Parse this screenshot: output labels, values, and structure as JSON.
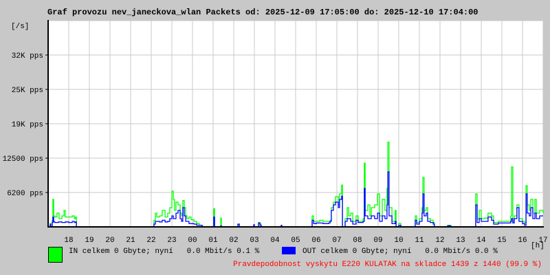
{
  "title": "Graf provozu nev_janeckova_wlan Packets od: 2025-12-09 17:05:00 do: 2025-12-10 17:04:00",
  "legend": {
    "in": {
      "text": "IN celkem 0 Gbyte; nyní   0.0 Mbit/s 0.1 %",
      "color": "#00ff00"
    },
    "out": {
      "text": "OUT celkem 0 Gbyte; nyní   0.0 Mbit/s 0.0 %",
      "color": "#0000ff"
    }
  },
  "footer": {
    "text": "Pravdepodobnost vyskytu E220 KULATAK na skladce 1439 z 1440 (99.9 %)",
    "color": "#ff0000"
  },
  "chart_data": {
    "type": "line",
    "title": "Graf provozu nev_janeckova_wlan Packets od: 2025-12-09 17:05:00 do: 2025-12-10 17:04:00",
    "ylabel": "[/s]",
    "xlabel": "[h]",
    "ylim": [
      0,
      37500
    ],
    "xlim_hours": [
      0,
      24
    ],
    "grid": true,
    "y_ticks": [
      {
        "value": 6250,
        "label": "6200 pps"
      },
      {
        "value": 12500,
        "label": "12500 pps"
      },
      {
        "value": 18750,
        "label": "19K pps"
      },
      {
        "value": 25000,
        "label": "25K pps"
      },
      {
        "value": 31250,
        "label": "32K pps"
      }
    ],
    "x_ticks": [
      "18",
      "19",
      "20",
      "21",
      "22",
      "23",
      "00",
      "01",
      "02",
      "03",
      "04",
      "05",
      "06",
      "07",
      "08",
      "09",
      "10",
      "11",
      "12",
      "13",
      "14",
      "15",
      "16",
      "17"
    ],
    "series": [
      {
        "name": "IN",
        "color": "#00ff00",
        "points": [
          [
            0,
            0
          ],
          [
            0.07,
            0
          ],
          [
            0.1,
            600
          ],
          [
            0.13,
            0
          ],
          [
            0.2,
            1200
          ],
          [
            0.23,
            5000
          ],
          [
            0.27,
            2000
          ],
          [
            0.33,
            1800
          ],
          [
            0.43,
            2500
          ],
          [
            0.53,
            1500
          ],
          [
            0.67,
            2000
          ],
          [
            0.77,
            3000
          ],
          [
            0.83,
            1800
          ],
          [
            1.0,
            1800
          ],
          [
            1.17,
            2000
          ],
          [
            1.27,
            1500
          ],
          [
            1.33,
            1800
          ],
          [
            1.37,
            0
          ],
          [
            5.07,
            0
          ],
          [
            5.13,
            1200
          ],
          [
            5.2,
            2500
          ],
          [
            5.27,
            1800
          ],
          [
            5.4,
            2000
          ],
          [
            5.53,
            3000
          ],
          [
            5.67,
            1800
          ],
          [
            5.8,
            2500
          ],
          [
            5.9,
            3500
          ],
          [
            6.0,
            6500
          ],
          [
            6.07,
            5000
          ],
          [
            6.13,
            3000
          ],
          [
            6.2,
            4500
          ],
          [
            6.3,
            4000
          ],
          [
            6.4,
            2500
          ],
          [
            6.47,
            2000
          ],
          [
            6.53,
            4800
          ],
          [
            6.6,
            3500
          ],
          [
            6.67,
            2000
          ],
          [
            6.73,
            1500
          ],
          [
            6.83,
            1800
          ],
          [
            6.93,
            1300
          ],
          [
            7.07,
            1000
          ],
          [
            7.2,
            600
          ],
          [
            7.33,
            300
          ],
          [
            7.47,
            0
          ],
          [
            8.0,
            0
          ],
          [
            8.03,
            3300
          ],
          [
            8.07,
            0
          ],
          [
            8.33,
            0
          ],
          [
            8.37,
            1600
          ],
          [
            8.4,
            0
          ],
          [
            9.17,
            0
          ],
          [
            9.2,
            500
          ],
          [
            9.27,
            0
          ],
          [
            10.17,
            0
          ],
          [
            10.2,
            800
          ],
          [
            10.27,
            500
          ],
          [
            10.33,
            0
          ],
          [
            12.73,
            0
          ],
          [
            12.8,
            2000
          ],
          [
            12.87,
            1000
          ],
          [
            13.0,
            1000
          ],
          [
            13.17,
            1200
          ],
          [
            13.33,
            1000
          ],
          [
            13.6,
            1000
          ],
          [
            13.67,
            1200
          ],
          [
            13.73,
            3500
          ],
          [
            13.83,
            4500
          ],
          [
            13.93,
            5500
          ],
          [
            14.07,
            4000
          ],
          [
            14.13,
            6000
          ],
          [
            14.23,
            7600
          ],
          [
            14.27,
            0
          ],
          [
            14.4,
            1500
          ],
          [
            14.5,
            3500
          ],
          [
            14.57,
            2000
          ],
          [
            14.67,
            2500
          ],
          [
            14.77,
            1000
          ],
          [
            14.93,
            2000
          ],
          [
            15.03,
            1000
          ],
          [
            15.27,
            1500
          ],
          [
            15.33,
            11600
          ],
          [
            15.37,
            3000
          ],
          [
            15.5,
            4000
          ],
          [
            15.6,
            2000
          ],
          [
            15.67,
            3500
          ],
          [
            15.83,
            4000
          ],
          [
            15.97,
            6000
          ],
          [
            16.07,
            2000
          ],
          [
            16.2,
            5000
          ],
          [
            16.33,
            3000
          ],
          [
            16.43,
            7000
          ],
          [
            16.47,
            15400
          ],
          [
            16.53,
            3500
          ],
          [
            16.67,
            1000
          ],
          [
            16.83,
            3000
          ],
          [
            16.87,
            0
          ],
          [
            17.0,
            600
          ],
          [
            17.1,
            0
          ],
          [
            17.73,
            0
          ],
          [
            17.8,
            2000
          ],
          [
            17.87,
            800
          ],
          [
            18.0,
            1500
          ],
          [
            18.13,
            3500
          ],
          [
            18.17,
            9000
          ],
          [
            18.23,
            3000
          ],
          [
            18.33,
            3500
          ],
          [
            18.4,
            1500
          ],
          [
            18.53,
            1200
          ],
          [
            18.67,
            800
          ],
          [
            18.73,
            0
          ],
          [
            19.33,
            0
          ],
          [
            19.37,
            300
          ],
          [
            19.5,
            200
          ],
          [
            19.53,
            0
          ],
          [
            20.67,
            0
          ],
          [
            20.73,
            6000
          ],
          [
            20.8,
            1500
          ],
          [
            20.9,
            3000
          ],
          [
            21.0,
            1500
          ],
          [
            21.17,
            1600
          ],
          [
            21.33,
            2500
          ],
          [
            21.5,
            2000
          ],
          [
            21.6,
            800
          ],
          [
            21.83,
            1000
          ],
          [
            22.07,
            1000
          ],
          [
            22.27,
            1000
          ],
          [
            22.43,
            2000
          ],
          [
            22.47,
            10900
          ],
          [
            22.53,
            1000
          ],
          [
            22.6,
            2000
          ],
          [
            22.73,
            4000
          ],
          [
            22.83,
            1500
          ],
          [
            23.0,
            1000
          ],
          [
            23.1,
            800
          ],
          [
            23.17,
            7500
          ],
          [
            23.23,
            4000
          ],
          [
            23.33,
            3000
          ],
          [
            23.4,
            5000
          ],
          [
            23.5,
            2500
          ],
          [
            23.6,
            5000
          ],
          [
            23.67,
            2500
          ],
          [
            23.83,
            3000
          ],
          [
            24.0,
            2500
          ]
        ]
      },
      {
        "name": "OUT",
        "color": "#0000ff",
        "points": [
          [
            0,
            0
          ],
          [
            0.07,
            0
          ],
          [
            0.1,
            500
          ],
          [
            0.13,
            0
          ],
          [
            0.2,
            800
          ],
          [
            0.23,
            1800
          ],
          [
            0.27,
            900
          ],
          [
            0.33,
            800
          ],
          [
            0.5,
            900
          ],
          [
            0.67,
            800
          ],
          [
            0.83,
            900
          ],
          [
            1.0,
            800
          ],
          [
            1.17,
            1000
          ],
          [
            1.27,
            800
          ],
          [
            1.33,
            900
          ],
          [
            1.37,
            0
          ],
          [
            5.07,
            0
          ],
          [
            5.13,
            500
          ],
          [
            5.2,
            1000
          ],
          [
            5.4,
            900
          ],
          [
            5.53,
            1200
          ],
          [
            5.67,
            900
          ],
          [
            5.8,
            1000
          ],
          [
            5.9,
            1500
          ],
          [
            6.0,
            2000
          ],
          [
            6.07,
            1500
          ],
          [
            6.2,
            2500
          ],
          [
            6.3,
            3000
          ],
          [
            6.4,
            1500
          ],
          [
            6.47,
            1000
          ],
          [
            6.53,
            3500
          ],
          [
            6.6,
            2000
          ],
          [
            6.67,
            1000
          ],
          [
            6.83,
            600
          ],
          [
            7.07,
            500
          ],
          [
            7.2,
            300
          ],
          [
            7.47,
            0
          ],
          [
            8.0,
            0
          ],
          [
            8.03,
            1800
          ],
          [
            8.07,
            0
          ],
          [
            8.33,
            0
          ],
          [
            8.37,
            200
          ],
          [
            8.4,
            0
          ],
          [
            9.17,
            0
          ],
          [
            9.2,
            500
          ],
          [
            9.27,
            0
          ],
          [
            9.93,
            0
          ],
          [
            9.97,
            400
          ],
          [
            10.0,
            0
          ],
          [
            10.17,
            0
          ],
          [
            10.2,
            700
          ],
          [
            10.27,
            300
          ],
          [
            10.33,
            0
          ],
          [
            11.27,
            0
          ],
          [
            11.3,
            300
          ],
          [
            11.33,
            0
          ],
          [
            12.73,
            0
          ],
          [
            12.8,
            1200
          ],
          [
            12.87,
            600
          ],
          [
            13.0,
            700
          ],
          [
            13.33,
            600
          ],
          [
            13.6,
            700
          ],
          [
            13.67,
            1000
          ],
          [
            13.73,
            3000
          ],
          [
            13.83,
            4000
          ],
          [
            13.93,
            4500
          ],
          [
            14.07,
            3500
          ],
          [
            14.13,
            5000
          ],
          [
            14.23,
            5600
          ],
          [
            14.27,
            0
          ],
          [
            14.4,
            1000
          ],
          [
            14.5,
            1500
          ],
          [
            14.67,
            1000
          ],
          [
            14.77,
            500
          ],
          [
            14.93,
            1200
          ],
          [
            15.03,
            800
          ],
          [
            15.27,
            1000
          ],
          [
            15.33,
            7000
          ],
          [
            15.37,
            2000
          ],
          [
            15.5,
            1500
          ],
          [
            15.67,
            2000
          ],
          [
            15.83,
            1500
          ],
          [
            15.97,
            2500
          ],
          [
            16.07,
            1000
          ],
          [
            16.2,
            2000
          ],
          [
            16.33,
            1500
          ],
          [
            16.43,
            4000
          ],
          [
            16.47,
            10000
          ],
          [
            16.53,
            2000
          ],
          [
            16.67,
            600
          ],
          [
            16.83,
            1000
          ],
          [
            16.87,
            0
          ],
          [
            17.0,
            300
          ],
          [
            17.1,
            0
          ],
          [
            17.73,
            0
          ],
          [
            17.8,
            1200
          ],
          [
            17.87,
            500
          ],
          [
            18.0,
            1000
          ],
          [
            18.13,
            2500
          ],
          [
            18.17,
            6000
          ],
          [
            18.23,
            2000
          ],
          [
            18.33,
            2500
          ],
          [
            18.4,
            1000
          ],
          [
            18.53,
            800
          ],
          [
            18.67,
            500
          ],
          [
            18.73,
            0
          ],
          [
            19.33,
            0
          ],
          [
            19.37,
            200
          ],
          [
            19.5,
            200
          ],
          [
            19.53,
            0
          ],
          [
            20.67,
            0
          ],
          [
            20.73,
            4000
          ],
          [
            20.8,
            800
          ],
          [
            20.9,
            1500
          ],
          [
            21.0,
            1000
          ],
          [
            21.17,
            1000
          ],
          [
            21.33,
            1800
          ],
          [
            21.5,
            1200
          ],
          [
            21.6,
            500
          ],
          [
            21.83,
            700
          ],
          [
            22.07,
            700
          ],
          [
            22.27,
            700
          ],
          [
            22.43,
            1000
          ],
          [
            22.47,
            1500
          ],
          [
            22.53,
            700
          ],
          [
            22.6,
            1500
          ],
          [
            22.73,
            3500
          ],
          [
            22.83,
            1000
          ],
          [
            23.0,
            600
          ],
          [
            23.1,
            300
          ],
          [
            23.17,
            6000
          ],
          [
            23.23,
            2500
          ],
          [
            23.33,
            2000
          ],
          [
            23.4,
            3500
          ],
          [
            23.5,
            1500
          ],
          [
            23.6,
            2500
          ],
          [
            23.67,
            1500
          ],
          [
            23.83,
            2000
          ],
          [
            24.0,
            2000
          ]
        ]
      }
    ]
  }
}
